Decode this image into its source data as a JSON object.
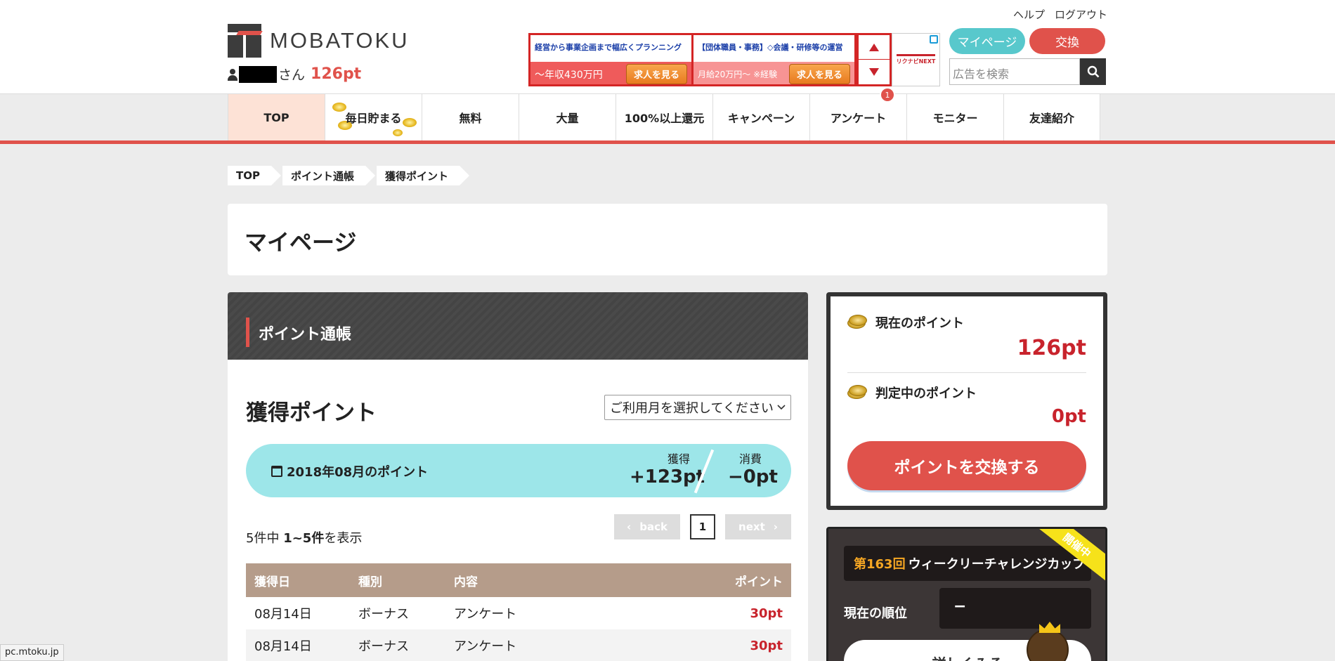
{
  "header": {
    "logo_text": "MOBATOKU",
    "user_suffix": "さん",
    "user_points": "126pt",
    "links": [
      "ヘルプ",
      "ログアウト"
    ],
    "mypage_label": "マイページ",
    "exchange_label": "交換",
    "ad_search_placeholder": "広告を検索"
  },
  "ad": {
    "ad1_title": "経営から事業企画まで幅広くプランニング",
    "ad1_salary": "～年収430万円",
    "ad1_button": "求人を見る",
    "ad2_title": "【団体職員・事務】◇会議・研修等の運営",
    "ad2_salary": "月給20万円～ ※経験",
    "ad2_button": "求人を見る",
    "ad_logo_text": "リクナビNEXT"
  },
  "nav": {
    "items": [
      "TOP",
      "毎日貯まる",
      "無料",
      "大量",
      "100%以上還元",
      "キャンペーン",
      "アンケート",
      "モニター",
      "友達紹介"
    ],
    "badge": "1"
  },
  "breadcrumb": [
    "TOP",
    "ポイント通帳",
    "獲得ポイント"
  ],
  "page_title": "マイページ",
  "panel": {
    "title": "ポイント通帳",
    "section_title": "獲得ポイント",
    "month_select": "ご利用月を選択してください",
    "summary": {
      "month": "2018年08月のポイント",
      "earned_label": "獲得",
      "earned_value": "+123pt",
      "spent_label": "消費",
      "spent_value": "−0pt"
    },
    "count_prefix": "5件中 ",
    "count_range": "1~5件",
    "count_suffix": "を表示",
    "pager": {
      "back": "back",
      "page": "1",
      "next": "next"
    },
    "table": {
      "headers": [
        "獲得日",
        "種別",
        "内容",
        "ポイント"
      ],
      "rows": [
        {
          "date": "08月14日",
          "type": "ボーナス",
          "content": "アンケート",
          "points": "30pt"
        },
        {
          "date": "08月14日",
          "type": "ボーナス",
          "content": "アンケート",
          "points": "30pt"
        }
      ]
    }
  },
  "points_box": {
    "current_label": "現在のポイント",
    "current_value": "126pt",
    "pending_label": "判定中のポイント",
    "pending_value": "0pt",
    "exchange_button": "ポイントを交換する"
  },
  "weekly": {
    "round": "第163回",
    "title": "ウィークリーチャレンジカップ",
    "ribbon": "開催中",
    "rank_label": "現在の順位",
    "rank_value": "−",
    "detail_button": "詳しくみる"
  },
  "status_url": "pc.mtoku.jp",
  "colors": {
    "accent_red": "#e0524b",
    "teal": "#58c8cc",
    "summary_bg": "#9de6e9",
    "table_header": "#b59c8a"
  }
}
